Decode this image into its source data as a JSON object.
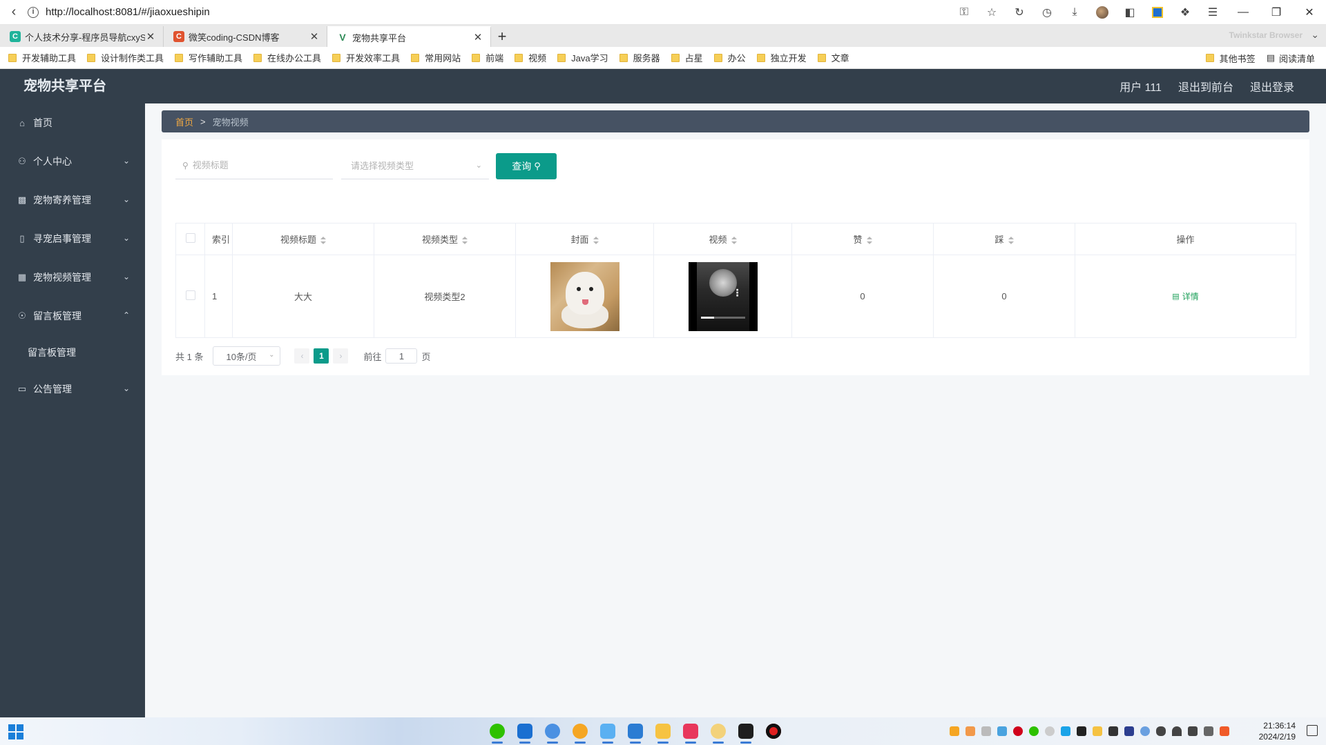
{
  "browser": {
    "url": "http://localhost:8081/#/jiaoxueshipin",
    "tabs": [
      {
        "title": "个人技术分享-程序员导航cxyS",
        "fav_color": "#1fb39a",
        "fav_char": "C"
      },
      {
        "title": "微笑coding-CSDN博客",
        "fav_color": "#e0532f",
        "fav_char": "C"
      },
      {
        "title": "宠物共享平台",
        "fav_color": "#ffffff",
        "fav_char": "V"
      }
    ],
    "brand": "Twinkstar Browser",
    "bookmarks": [
      "开发辅助工具",
      "设计制作类工具",
      "写作辅助工具",
      "在线办公工具",
      "开发效率工具",
      "常用网站",
      "前端",
      "视频",
      "Java学习",
      "服务器",
      "占星",
      "办公",
      "独立开发",
      "文章"
    ],
    "bookmarks_right": [
      "其他书签",
      "阅读清单"
    ]
  },
  "header": {
    "title": "宠物共享平台",
    "user": "用户 111",
    "to_front": "退出到前台",
    "logout": "退出登录"
  },
  "sidebar": {
    "items": [
      {
        "label": "首页",
        "icon": "home-icon"
      },
      {
        "label": "个人中心",
        "icon": "user-icon"
      },
      {
        "label": "宠物寄养管理",
        "icon": "briefcase-icon"
      },
      {
        "label": "寻宠启事管理",
        "icon": "phone-icon"
      },
      {
        "label": "宠物视频管理",
        "icon": "clipboard-icon"
      },
      {
        "label": "留言板管理",
        "icon": "compass-icon"
      },
      {
        "label": "公告管理",
        "icon": "monitor-icon"
      }
    ],
    "sub_item": "留言板管理"
  },
  "breadcrumb": {
    "home": "首页",
    "sep": ">",
    "current": "宠物视频"
  },
  "search": {
    "title_placeholder": "视频标题",
    "type_placeholder": "请选择视频类型",
    "query_label": "查询"
  },
  "table": {
    "columns": [
      "索引",
      "视频标题",
      "视频类型",
      "封面",
      "视频",
      "赞",
      "踩",
      "操作"
    ],
    "rows": [
      {
        "index": "1",
        "title": "大大",
        "type": "视频类型2",
        "likes": "0",
        "dislikes": "0",
        "action": "详情",
        "video_progress": 0.3
      }
    ]
  },
  "pagination": {
    "total": "共 1 条",
    "page_size": "10条/页",
    "current_page": "1",
    "goto_label": "前往",
    "goto_value": "1",
    "page_unit": "页"
  },
  "taskbar": {
    "time": "21:36:14",
    "date": "2024/2/19"
  },
  "colors": {
    "sidebar_bg": "#333f4b",
    "accent": "#0b9b8a",
    "breadcrumb_home": "#f0a842",
    "detail_link": "#1ea05a"
  }
}
